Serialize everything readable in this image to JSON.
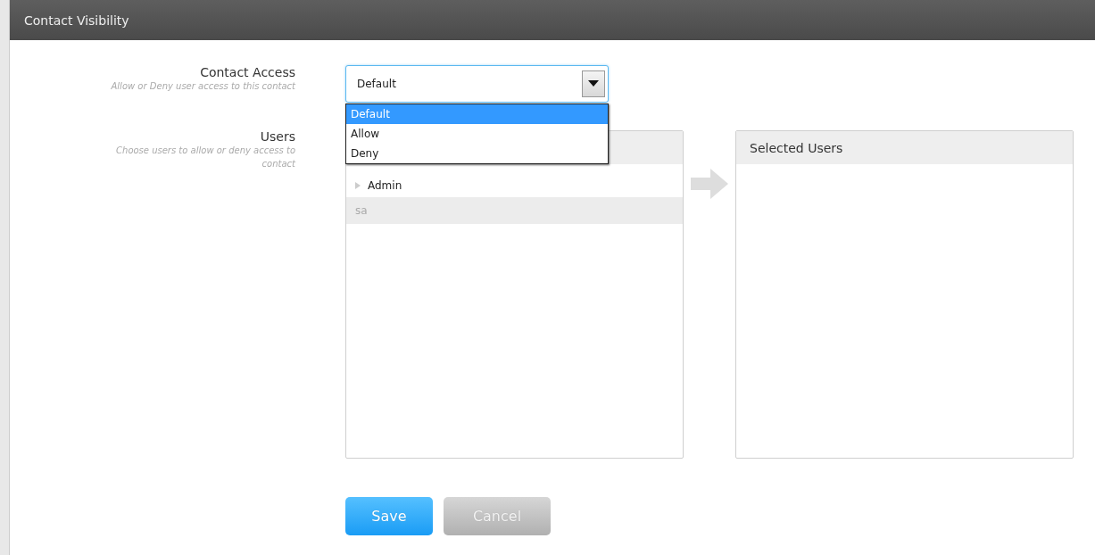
{
  "window": {
    "title": "Contact Visibility"
  },
  "contact_access": {
    "label": "Contact Access",
    "hint": "Allow or Deny user access to this contact",
    "value": "Default",
    "expanded": true,
    "options": [
      {
        "label": "Default",
        "selected": true
      },
      {
        "label": "Allow",
        "selected": false
      },
      {
        "label": "Deny",
        "selected": false
      }
    ]
  },
  "users": {
    "label": "Users",
    "hint": "Choose users to allow or deny access to contact",
    "available": [
      {
        "label": "Admin",
        "expanded": false,
        "disabled": false
      },
      {
        "label": "sa",
        "disabled": true
      }
    ],
    "selected_panel": {
      "title": "Selected Users"
    }
  },
  "buttons": [
    {
      "label": "Save",
      "kind": "primary"
    },
    {
      "label": "Cancel",
      "kind": "secondary"
    }
  ]
}
